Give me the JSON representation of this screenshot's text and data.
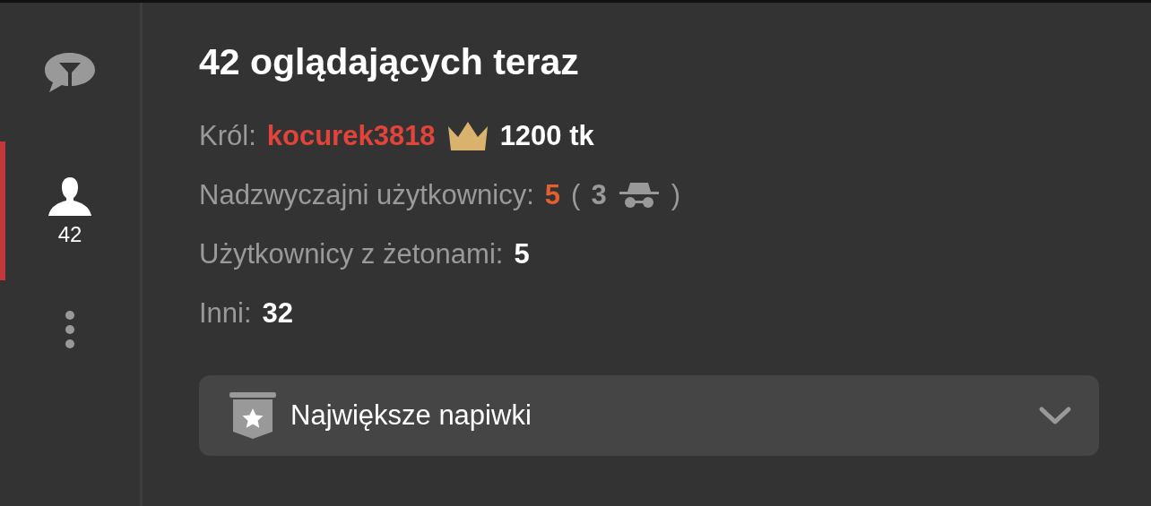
{
  "sidebar": {
    "items": [
      {
        "kind": "filter",
        "selected": false
      },
      {
        "kind": "users",
        "count": "42",
        "selected": true
      },
      {
        "kind": "more",
        "selected": false
      }
    ]
  },
  "title": "42 oglądających teraz",
  "rows": [
    {
      "kind": "king",
      "label": "Król:",
      "name": "kocurek3818",
      "amount": "1200 tk"
    },
    {
      "kind": "special",
      "label": "Nadzwyczajni użytkownicy:",
      "value": "5",
      "open": "(",
      "hidden": "3",
      "close": ")"
    },
    {
      "kind": "plain",
      "label": "Użytkownicy z żetonami:",
      "value": "5"
    },
    {
      "kind": "plain",
      "label": "Inni:",
      "value": "32"
    }
  ],
  "dropdown": {
    "label": "Największe napiwki",
    "expanded": false
  }
}
